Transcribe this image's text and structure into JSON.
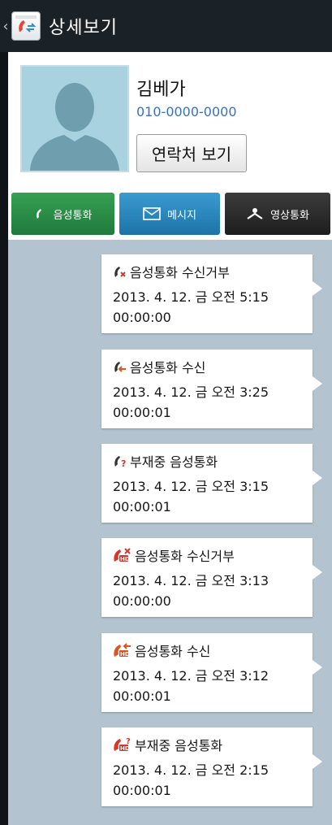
{
  "titlebar": {
    "back_icon": "chevron-left-icon",
    "app_icon": "phone-log-icon",
    "title": "상세보기"
  },
  "contact": {
    "name": "김베가",
    "phone": "010-0000-0000",
    "view_contact_label": "연락처 보기",
    "photo_icon": "person-silhouette-icon"
  },
  "actions": {
    "voice_call": {
      "label": "음성통화",
      "icon": "phone-handset-icon"
    },
    "message": {
      "label": "메시지",
      "icon": "envelope-icon"
    },
    "video_call": {
      "label": "영상통화",
      "icon": "video-person-icon"
    }
  },
  "colors": {
    "voice_call": "#2a8a45",
    "message": "#2a86bd",
    "video_call": "#2b2b2b",
    "log_background": "#b3c4d0",
    "accent_red": "#d9362b"
  },
  "call_log": [
    {
      "type": "음성통화 수신거부",
      "icon": "call-rejected-icon",
      "datetime": "2013. 4. 12. 금 오전 5:15",
      "duration": "00:00:00"
    },
    {
      "type": "음성통화 수신",
      "icon": "call-received-icon",
      "datetime": "2013. 4. 12. 금 오전 3:25",
      "duration": "00:00:01"
    },
    {
      "type": "부재중 음성통화",
      "icon": "call-missed-icon",
      "datetime": "2013. 4. 12. 금 오전 3:15",
      "duration": "00:00:01"
    },
    {
      "type": "음성통화 수신거부",
      "icon": "hd-call-rejected-icon",
      "datetime": "2013. 4. 12. 금 오전 3:13",
      "duration": "00:00:00"
    },
    {
      "type": "음성통화 수신",
      "icon": "hd-call-received-icon",
      "datetime": "2013. 4. 12. 금 오전 3:12",
      "duration": "00:00:01"
    },
    {
      "type": "부재중 음성통화",
      "icon": "hd-call-missed-icon",
      "datetime": "2013. 4. 12. 금 오전 2:15",
      "duration": "00:00:01"
    }
  ]
}
